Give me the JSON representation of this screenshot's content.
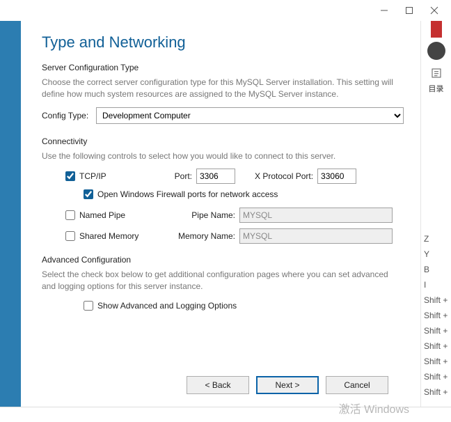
{
  "titlebar": {
    "min": "—",
    "max": "▢",
    "close": "✕"
  },
  "heading": "Type and Networking",
  "section1_title": "Server Configuration Type",
  "section1_help": "Choose the correct server configuration type for this MySQL Server installation. This setting will define how much system resources are assigned to the MySQL Server instance.",
  "configtype_label": "Config Type:",
  "configtype_value": "Development Computer",
  "section2_title": "Connectivity",
  "section2_help": "Use the following controls to select how you would like to connect to this server.",
  "tcpip_label": "TCP/IP",
  "port_label": "Port:",
  "port_value": "3306",
  "xport_label": "X Protocol Port:",
  "xport_value": "33060",
  "firewall_label": "Open Windows Firewall ports for network access",
  "namedpipe_label": "Named Pipe",
  "pipename_label": "Pipe Name:",
  "pipename_value": "MYSQL",
  "sharedmem_label": "Shared Memory",
  "memname_label": "Memory Name:",
  "memname_value": "MYSQL",
  "section3_title": "Advanced Configuration",
  "section3_help": "Select the check box below to get additional configuration pages where you can set advanced and logging options for this server instance.",
  "advopt_label": "Show Advanced and Logging Options",
  "btn_back": "< Back",
  "btn_next": "Next >",
  "btn_cancel": "Cancel",
  "watermark": "激活 Windows",
  "sidebar_toc": "目录",
  "rlist": [
    "Z",
    "Y",
    "B",
    "I",
    "Shift +",
    "Shift +",
    "Shift +",
    "Shift +",
    "Shift +",
    "Shift +",
    "Shift +"
  ]
}
